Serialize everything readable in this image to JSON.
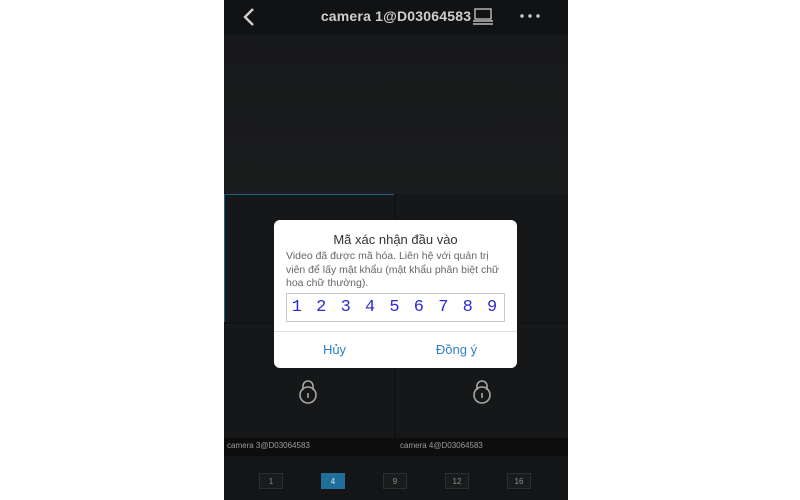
{
  "header": {
    "title": "camera 1@D03064583",
    "back_icon": "chevron-left-icon",
    "cast_icon": "screen-cast-icon",
    "more_icon": "more-dots-icon"
  },
  "cameras": {
    "cam3_label": "camera 3@D03064583",
    "cam4_label": "camera 4@D03064583",
    "lock_icon": "padlock-icon"
  },
  "layout_buttons": [
    {
      "label": "1",
      "active": false
    },
    {
      "label": "4",
      "active": true
    },
    {
      "label": "9",
      "active": false
    },
    {
      "label": "12",
      "active": false
    },
    {
      "label": "16",
      "active": false
    }
  ],
  "dialog": {
    "title": "Mã xác nhận đầu vào",
    "message": "Video đã được mã hóa. Liên hệ với quản trị viên để lấy mật khẩu (mật khẩu phân biệt chữ hoa chữ thường).",
    "input_value": "1 2 3 4 5 6 7 8 9",
    "cancel_label": "Hủy",
    "ok_label": "Đồng ý"
  },
  "colors": {
    "accent": "#2f7fc2",
    "input_text": "#2b2bd0",
    "active_layout": "#1f6f9a",
    "background": "#111213"
  }
}
